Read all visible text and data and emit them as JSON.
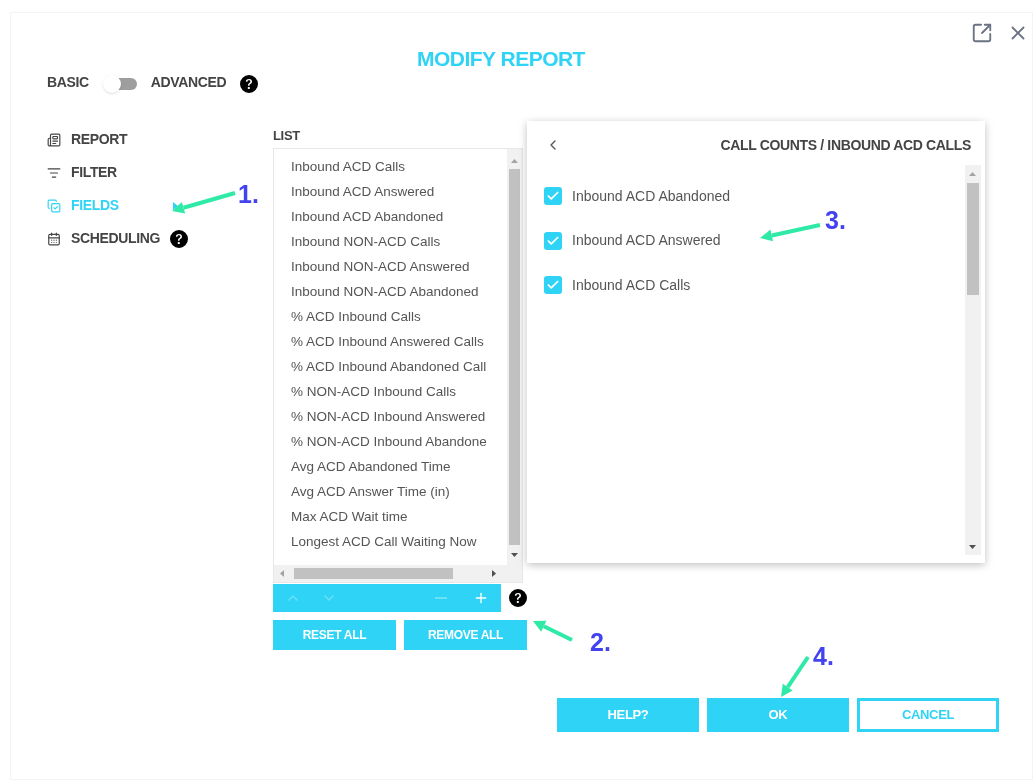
{
  "window": {
    "title": "MODIFY REPORT"
  },
  "mode_toggle": {
    "left_label": "BASIC",
    "right_label": "ADVANCED",
    "on": false
  },
  "nav": [
    {
      "label": "REPORT",
      "selected": false,
      "help": false
    },
    {
      "label": "FILTER",
      "selected": false,
      "help": false
    },
    {
      "label": "FIELDS",
      "selected": true,
      "help": false
    },
    {
      "label": "SCHEDULING",
      "selected": false,
      "help": true
    }
  ],
  "list": {
    "label": "LIST",
    "items": [
      "Inbound ACD Calls",
      "Inbound ACD Answered",
      "Inbound ACD Abandoned",
      "Inbound NON-ACD Calls",
      "Inbound NON-ACD Answered",
      "Inbound NON-ACD Abandoned",
      "% ACD Inbound Calls",
      "% ACD Inbound Answered Calls",
      "% ACD Inbound Abandoned Call",
      "% NON-ACD Inbound Calls",
      "% NON-ACD Inbound Answered",
      "% NON-ACD Inbound Abandone",
      "Avg ACD Abandoned Time",
      "Avg ACD Answer Time (in)",
      "Max ACD Wait time",
      "Longest ACD Call Waiting Now"
    ]
  },
  "toolbar": [
    {
      "kind": "up",
      "disabled": true
    },
    {
      "kind": "down",
      "disabled": true
    },
    {
      "kind": "remove",
      "disabled": true
    },
    {
      "kind": "add",
      "disabled": false
    }
  ],
  "list_actions": [
    "RESET ALL",
    "REMOVE ALL"
  ],
  "panel": {
    "title": "CALL COUNTS / INBOUND ACD CALLS",
    "items": [
      {
        "label": "Inbound ACD Abandoned",
        "checked": true
      },
      {
        "label": "Inbound ACD Answered",
        "checked": true
      },
      {
        "label": "Inbound ACD Calls",
        "checked": true
      }
    ]
  },
  "buttons": [
    {
      "label": "HELP?",
      "kind": "filled"
    },
    {
      "label": "OK",
      "kind": "filled"
    },
    {
      "label": "CANCEL",
      "kind": "outline"
    }
  ],
  "annotations": [
    "1.",
    "2.",
    "3.",
    "4."
  ]
}
